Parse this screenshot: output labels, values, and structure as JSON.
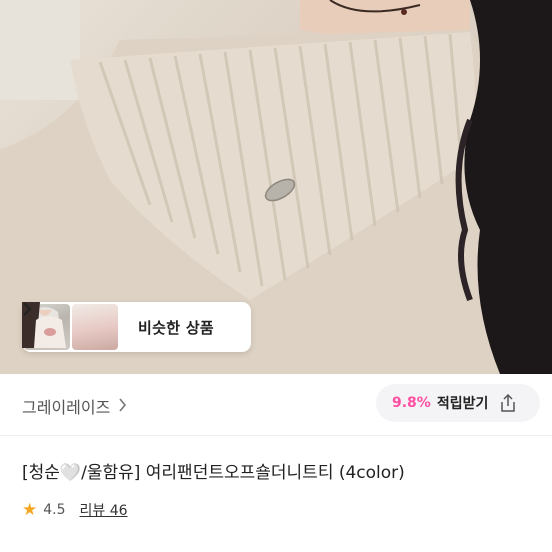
{
  "similar_products": {
    "label": "비슷한 상품",
    "chevron_icon": "chevron-right-icon",
    "thumbnails": [
      "thumbnail-1",
      "thumbnail-2"
    ]
  },
  "store": {
    "name": "그레이레이즈",
    "chevron_icon": "chevron-right-icon"
  },
  "reward": {
    "percent": "9.8%",
    "label": "적립받기",
    "icon": "share-icon"
  },
  "product": {
    "title_prefix": "[청순",
    "title_heart": "🤍",
    "title_rest": "/울함유] 여리팬던트오프숄더니트티 (4color)"
  },
  "rating": {
    "value": "4.5",
    "review_label": "리뷰 46",
    "icon": "star-icon"
  },
  "colors": {
    "accent": "#ff4fa3",
    "star": "#f5a623"
  }
}
